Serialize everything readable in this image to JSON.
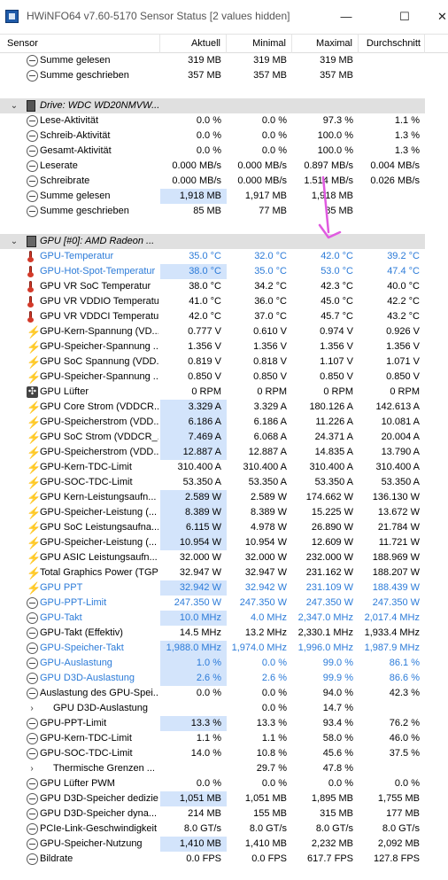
{
  "window": {
    "title": "HWiNFO64 v7.60-5170 Sensor Status [2 values hidden]",
    "minimize_glyph": "—",
    "maximize_glyph": "☐",
    "close_glyph": "✕"
  },
  "columns": [
    "Sensor",
    "Aktuell",
    "Minimal",
    "Maximal",
    "Durchschnitt"
  ],
  "colors": {
    "highlight": "#d3e4fb",
    "blue_text": "#2c7bd8",
    "group_bg": "#e0e0e0",
    "arrow": "#e05ae0"
  },
  "rows": [
    {
      "type": "sensor",
      "icon": "clock-icon",
      "label": "Summe gelesen",
      "cur": "319 MB",
      "min": "319 MB",
      "max": "319 MB",
      "avg": ""
    },
    {
      "type": "sensor",
      "icon": "clock-icon",
      "label": "Summe geschrieben",
      "cur": "357 MB",
      "min": "357 MB",
      "max": "357 MB",
      "avg": ""
    },
    {
      "type": "empty"
    },
    {
      "type": "group",
      "icon": "drive-icon",
      "label": "Drive: WDC WD20NMVW..."
    },
    {
      "type": "sensor",
      "icon": "clock-icon",
      "label": "Lese-Aktivität",
      "cur": "0.0 %",
      "min": "0.0 %",
      "max": "97.3 %",
      "avg": "1.1 %"
    },
    {
      "type": "sensor",
      "icon": "clock-icon",
      "label": "Schreib-Aktivität",
      "cur": "0.0 %",
      "min": "0.0 %",
      "max": "100.0 %",
      "avg": "1.3 %"
    },
    {
      "type": "sensor",
      "icon": "clock-icon",
      "label": "Gesamt-Aktivität",
      "cur": "0.0 %",
      "min": "0.0 %",
      "max": "100.0 %",
      "avg": "1.3 %"
    },
    {
      "type": "sensor",
      "icon": "clock-icon",
      "label": "Leserate",
      "cur": "0.000 MB/s",
      "min": "0.000 MB/s",
      "max": "0.897 MB/s",
      "avg": "0.004 MB/s"
    },
    {
      "type": "sensor",
      "icon": "clock-icon",
      "label": "Schreibrate",
      "cur": "0.000 MB/s",
      "min": "0.000 MB/s",
      "max": "1.514 MB/s",
      "avg": "0.026 MB/s"
    },
    {
      "type": "sensor",
      "icon": "clock-icon",
      "label": "Summe gelesen",
      "cur": "1,918 MB",
      "min": "1,917 MB",
      "max": "1,918 MB",
      "avg": "",
      "hl": true
    },
    {
      "type": "sensor",
      "icon": "clock-icon",
      "label": "Summe geschrieben",
      "cur": "85 MB",
      "min": "77 MB",
      "max": "85 MB",
      "avg": ""
    },
    {
      "type": "empty"
    },
    {
      "type": "group",
      "icon": "gpu-icon",
      "label": "GPU [#0]: AMD Radeon ..."
    },
    {
      "type": "sensor",
      "icon": "thermometer-icon",
      "label": "GPU-Temperatur",
      "cur": "35.0 °C",
      "min": "32.0 °C",
      "max": "42.0 °C",
      "avg": "39.2 °C",
      "blue": true
    },
    {
      "type": "sensor",
      "icon": "thermometer-icon",
      "label": "GPU-Hot-Spot-Temperatur",
      "cur": "38.0 °C",
      "min": "35.0 °C",
      "max": "53.0 °C",
      "avg": "47.4 °C",
      "blue": true,
      "hl": true
    },
    {
      "type": "sensor",
      "icon": "thermometer-icon",
      "label": "GPU VR SoC Temperatur",
      "cur": "38.0 °C",
      "min": "34.2 °C",
      "max": "42.3 °C",
      "avg": "40.0 °C"
    },
    {
      "type": "sensor",
      "icon": "thermometer-icon",
      "label": "GPU VR VDDIO Temperatur",
      "cur": "41.0 °C",
      "min": "36.0 °C",
      "max": "45.0 °C",
      "avg": "42.2 °C"
    },
    {
      "type": "sensor",
      "icon": "thermometer-icon",
      "label": "GPU VR VDDCI Temperatur",
      "cur": "42.0 °C",
      "min": "37.0 °C",
      "max": "45.7 °C",
      "avg": "43.2 °C"
    },
    {
      "type": "sensor",
      "icon": "bolt-icon",
      "label": "GPU-Kern-Spannung (VD...",
      "cur": "0.777 V",
      "min": "0.610 V",
      "max": "0.974 V",
      "avg": "0.926 V"
    },
    {
      "type": "sensor",
      "icon": "bolt-icon",
      "label": "GPU-Speicher-Spannung ...",
      "cur": "1.356 V",
      "min": "1.356 V",
      "max": "1.356 V",
      "avg": "1.356 V"
    },
    {
      "type": "sensor",
      "icon": "bolt-icon",
      "label": "GPU SoC Spannung (VDD...",
      "cur": "0.819 V",
      "min": "0.818 V",
      "max": "1.107 V",
      "avg": "1.071 V"
    },
    {
      "type": "sensor",
      "icon": "bolt-icon",
      "label": "GPU-Speicher-Spannung ...",
      "cur": "0.850 V",
      "min": "0.850 V",
      "max": "0.850 V",
      "avg": "0.850 V"
    },
    {
      "type": "sensor",
      "icon": "fan-icon",
      "label": "GPU Lüfter",
      "cur": "0 RPM",
      "min": "0 RPM",
      "max": "0 RPM",
      "avg": "0 RPM"
    },
    {
      "type": "sensor",
      "icon": "bolt-icon",
      "label": "GPU Core Strom (VDDCR...",
      "cur": "3.329 A",
      "min": "3.329 A",
      "max": "180.126 A",
      "avg": "142.613 A",
      "hl": true
    },
    {
      "type": "sensor",
      "icon": "bolt-icon",
      "label": "GPU-Speicherstrom (VDD...",
      "cur": "6.186 A",
      "min": "6.186 A",
      "max": "11.226 A",
      "avg": "10.081 A",
      "hl": true
    },
    {
      "type": "sensor",
      "icon": "bolt-icon",
      "label": "GPU SoC Strom (VDDCR_...",
      "cur": "7.469 A",
      "min": "6.068 A",
      "max": "24.371 A",
      "avg": "20.004 A",
      "hl": true
    },
    {
      "type": "sensor",
      "icon": "bolt-icon",
      "label": "GPU-Speicherstrom (VDD...",
      "cur": "12.887 A",
      "min": "12.887 A",
      "max": "14.835 A",
      "avg": "13.790 A",
      "hl": true
    },
    {
      "type": "sensor",
      "icon": "bolt-icon",
      "label": "GPU-Kern-TDC-Limit",
      "cur": "310.400 A",
      "min": "310.400 A",
      "max": "310.400 A",
      "avg": "310.400 A"
    },
    {
      "type": "sensor",
      "icon": "bolt-icon",
      "label": "GPU-SOC-TDC-Limit",
      "cur": "53.350 A",
      "min": "53.350 A",
      "max": "53.350 A",
      "avg": "53.350 A"
    },
    {
      "type": "sensor",
      "icon": "bolt-icon",
      "label": "GPU Kern-Leistungsaufn...",
      "cur": "2.589 W",
      "min": "2.589 W",
      "max": "174.662 W",
      "avg": "136.130 W",
      "hl": true
    },
    {
      "type": "sensor",
      "icon": "bolt-icon",
      "label": "GPU-Speicher-Leistung (...",
      "cur": "8.389 W",
      "min": "8.389 W",
      "max": "15.225 W",
      "avg": "13.672 W",
      "hl": true
    },
    {
      "type": "sensor",
      "icon": "bolt-icon",
      "label": "GPU SoC Leistungsaufna...",
      "cur": "6.115 W",
      "min": "4.978 W",
      "max": "26.890 W",
      "avg": "21.784 W",
      "hl": true
    },
    {
      "type": "sensor",
      "icon": "bolt-icon",
      "label": "GPU-Speicher-Leistung (...",
      "cur": "10.954 W",
      "min": "10.954 W",
      "max": "12.609 W",
      "avg": "11.721 W",
      "hl": true
    },
    {
      "type": "sensor",
      "icon": "bolt-icon",
      "label": "GPU ASIC Leistungsaufn...",
      "cur": "32.000 W",
      "min": "32.000 W",
      "max": "232.000 W",
      "avg": "188.969 W"
    },
    {
      "type": "sensor",
      "icon": "bolt-icon",
      "label": "Total Graphics Power (TGP)",
      "cur": "32.947 W",
      "min": "32.947 W",
      "max": "231.162 W",
      "avg": "188.207 W"
    },
    {
      "type": "sensor",
      "icon": "bolt-icon",
      "label": "GPU PPT",
      "cur": "32.942 W",
      "min": "32.942 W",
      "max": "231.109 W",
      "avg": "188.439 W",
      "blue": true,
      "hl": true
    },
    {
      "type": "sensor",
      "icon": "clock-icon",
      "label": "GPU-PPT-Limit",
      "cur": "247.350 W",
      "min": "247.350 W",
      "max": "247.350 W",
      "avg": "247.350 W",
      "blue": true
    },
    {
      "type": "sensor",
      "icon": "clock-icon",
      "label": "GPU-Takt",
      "cur": "10.0 MHz",
      "min": "4.0 MHz",
      "max": "2,347.0 MHz",
      "avg": "2,017.4 MHz",
      "blue": true,
      "hl": true
    },
    {
      "type": "sensor",
      "icon": "clock-icon",
      "label": "GPU-Takt (Effektiv)",
      "cur": "14.5 MHz",
      "min": "13.2 MHz",
      "max": "2,330.1 MHz",
      "avg": "1,933.4 MHz"
    },
    {
      "type": "sensor",
      "icon": "clock-icon",
      "label": "GPU-Speicher-Takt",
      "cur": "1,988.0 MHz",
      "min": "1,974.0 MHz",
      "max": "1,996.0 MHz",
      "avg": "1,987.9 MHz",
      "blue": true,
      "hl": true
    },
    {
      "type": "sensor",
      "icon": "clock-icon",
      "label": "GPU-Auslastung",
      "cur": "1.0 %",
      "min": "0.0 %",
      "max": "99.0 %",
      "avg": "86.1 %",
      "blue": true,
      "hl": true
    },
    {
      "type": "sensor",
      "icon": "clock-icon",
      "label": "GPU D3D-Auslastung",
      "cur": "2.6 %",
      "min": "2.6 %",
      "max": "99.9 %",
      "avg": "86.6 %",
      "blue": true,
      "hl": true
    },
    {
      "type": "sensor",
      "icon": "clock-icon",
      "label": "Auslastung des GPU-Spei...",
      "cur": "0.0 %",
      "min": "0.0 %",
      "max": "94.0 %",
      "avg": "42.3 %"
    },
    {
      "type": "expand",
      "label": "GPU D3D-Auslastung",
      "cur": "",
      "min": "0.0 %",
      "max": "14.7 %",
      "avg": ""
    },
    {
      "type": "sensor",
      "icon": "clock-icon",
      "label": "GPU-PPT-Limit",
      "cur": "13.3 %",
      "min": "13.3 %",
      "max": "93.4 %",
      "avg": "76.2 %",
      "hl": true
    },
    {
      "type": "sensor",
      "icon": "clock-icon",
      "label": "GPU-Kern-TDC-Limit",
      "cur": "1.1 %",
      "min": "1.1 %",
      "max": "58.0 %",
      "avg": "46.0 %"
    },
    {
      "type": "sensor",
      "icon": "clock-icon",
      "label": "GPU-SOC-TDC-Limit",
      "cur": "14.0 %",
      "min": "10.8 %",
      "max": "45.6 %",
      "avg": "37.5 %"
    },
    {
      "type": "expand",
      "label": "Thermische Grenzen ...",
      "cur": "",
      "min": "29.7 %",
      "max": "47.8 %",
      "avg": ""
    },
    {
      "type": "sensor",
      "icon": "clock-icon",
      "label": "GPU Lüfter PWM",
      "cur": "0.0 %",
      "min": "0.0 %",
      "max": "0.0 %",
      "avg": "0.0 %"
    },
    {
      "type": "sensor",
      "icon": "clock-icon",
      "label": "GPU D3D-Speicher dediziert",
      "cur": "1,051 MB",
      "min": "1,051 MB",
      "max": "1,895 MB",
      "avg": "1,755 MB",
      "hl": true
    },
    {
      "type": "sensor",
      "icon": "clock-icon",
      "label": "GPU D3D-Speicher dyna...",
      "cur": "214 MB",
      "min": "155 MB",
      "max": "315 MB",
      "avg": "177 MB"
    },
    {
      "type": "sensor",
      "icon": "clock-icon",
      "label": "PCIe-Link-Geschwindigkeit",
      "cur": "8.0 GT/s",
      "min": "8.0 GT/s",
      "max": "8.0 GT/s",
      "avg": "8.0 GT/s"
    },
    {
      "type": "sensor",
      "icon": "clock-icon",
      "label": "GPU-Speicher-Nutzung",
      "cur": "1,410 MB",
      "min": "1,410 MB",
      "max": "2,232 MB",
      "avg": "2,092 MB",
      "hl": true
    },
    {
      "type": "sensor",
      "icon": "clock-icon",
      "label": "Bildrate",
      "cur": "0.0 FPS",
      "min": "0.0 FPS",
      "max": "617.7 FPS",
      "avg": "127.8 FPS"
    }
  ]
}
